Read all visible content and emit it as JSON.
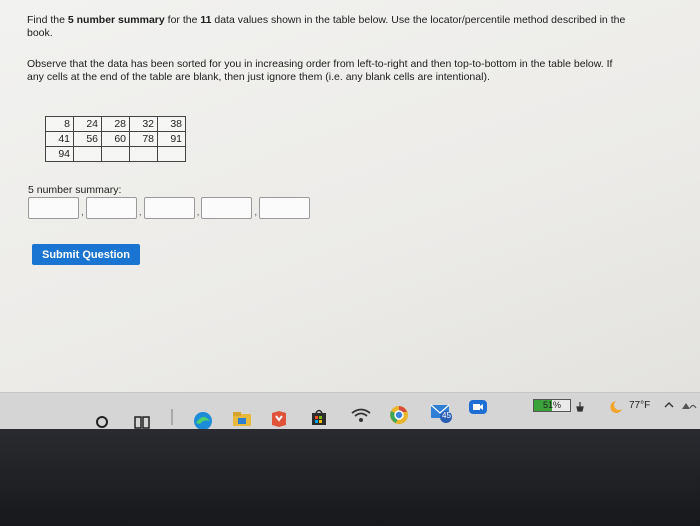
{
  "question": {
    "intro_prefix": "Find the ",
    "intro_bold1": "5 number summary",
    "intro_mid": " for the ",
    "intro_bold2": "11",
    "intro_suffix": " data values shown in the table below. Use the locator/percentile method described in the book.",
    "observe": "Observe that the data has been sorted for you in increasing order from left-to-right and then top-to-bottom in the table below. If any cells at the end of the table are blank, then just ignore them (i.e. any blank cells are intentional)."
  },
  "table": {
    "rows": [
      [
        "8",
        "24",
        "28",
        "32",
        "38"
      ],
      [
        "41",
        "56",
        "60",
        "78",
        "91"
      ],
      [
        "94",
        "",
        "",
        "",
        ""
      ]
    ]
  },
  "summary": {
    "label": "5 number summary:",
    "separator": ",",
    "values": [
      "",
      "",
      "",
      "",
      ""
    ]
  },
  "submit_label": "Submit Question",
  "taskbar": {
    "battery_percent": "51%",
    "battery_level": 0.51,
    "temperature": "77°F",
    "mail_badge": "45",
    "icons": [
      "search-circle-icon",
      "task-view-icon",
      "edge-icon",
      "file-explorer-icon",
      "office-icon",
      "store-icon",
      "wifi-icon",
      "chrome-icon",
      "mail-icon",
      "meet-icon",
      "battery-icon",
      "weather-icon",
      "chevron-up-icon"
    ]
  },
  "colors": {
    "accent": "#1a74d2",
    "screen_bg": "#eeeeec",
    "taskbar_bg": "#d4d5d4"
  }
}
